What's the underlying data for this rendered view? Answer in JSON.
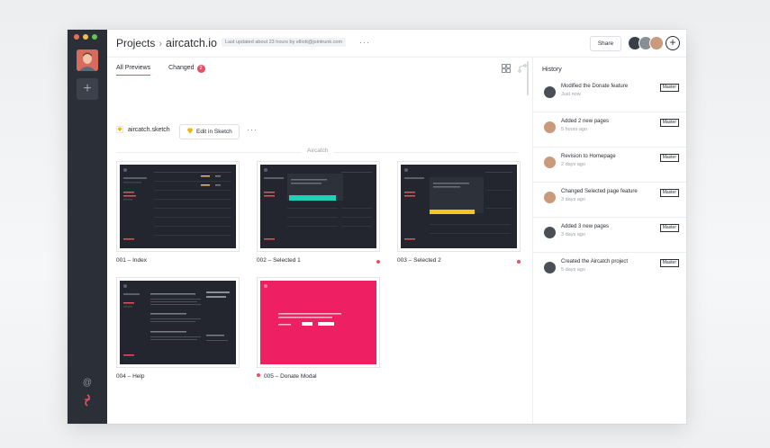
{
  "window": {
    "traffic_colors": [
      "#ed6a5e",
      "#f5bf4f",
      "#62c554"
    ]
  },
  "rail": {
    "add_glyph": "+",
    "at_glyph": "@",
    "logo_icon": "abstract-logo"
  },
  "header": {
    "projects_label": "Projects",
    "separator": "›",
    "project_name": "aircatch.io",
    "updated_text": "Last updated about 23 hours by elliott@jointrunk.com",
    "more": "···",
    "share_label": "Share",
    "add_member_glyph": "+"
  },
  "tabs": [
    {
      "label": "All Previews",
      "active": true
    },
    {
      "label": "Changed",
      "badge": "2"
    }
  ],
  "file": {
    "name": "aircatch.sketch",
    "edit_button": "Edit in Sketch",
    "more": "···"
  },
  "section": {
    "label": "Aircatch"
  },
  "artboards": [
    {
      "label": "001 – Index",
      "changed": false,
      "variant": "dark"
    },
    {
      "label": "002 – Selected 1",
      "changed": true,
      "variant": "teal"
    },
    {
      "label": "003 – Selected 2",
      "changed": true,
      "variant": "yellow"
    },
    {
      "label": "004 – Help",
      "changed": false,
      "variant": "help"
    },
    {
      "label": "005 – Donate Modal",
      "changed": true,
      "variant": "pink"
    }
  ],
  "history": {
    "title": "History",
    "items": [
      {
        "text": "Modified the Donate feature",
        "time": "Just now",
        "branch": "Master",
        "avatar_color": "#4a4f57"
      },
      {
        "text": "Added 2 new pages",
        "time": "5 hours ago",
        "branch": "Master",
        "avatar_color": "#c99a7c"
      },
      {
        "text": "Revision to Homepage",
        "time": "2 days ago",
        "branch": "Master",
        "avatar_color": "#c99a7c"
      },
      {
        "text": "Changed Selected page feature",
        "time": "3 days ago",
        "branch": "Master",
        "avatar_color": "#c99a7c"
      },
      {
        "text": "Added 3 new pages",
        "time": "3 days ago",
        "branch": "Master",
        "avatar_color": "#4a4f57"
      },
      {
        "text": "Created the Aircatch project",
        "time": "5 days ago",
        "branch": "Master",
        "avatar_color": "#4a4f57"
      }
    ]
  },
  "colors": {
    "accent": "#e94f63",
    "rail": "#2b2f38",
    "artboard_dark": "#23262e",
    "teal": "#1fd1b8",
    "yellow": "#f7c31d",
    "pink": "#ee1f63"
  }
}
